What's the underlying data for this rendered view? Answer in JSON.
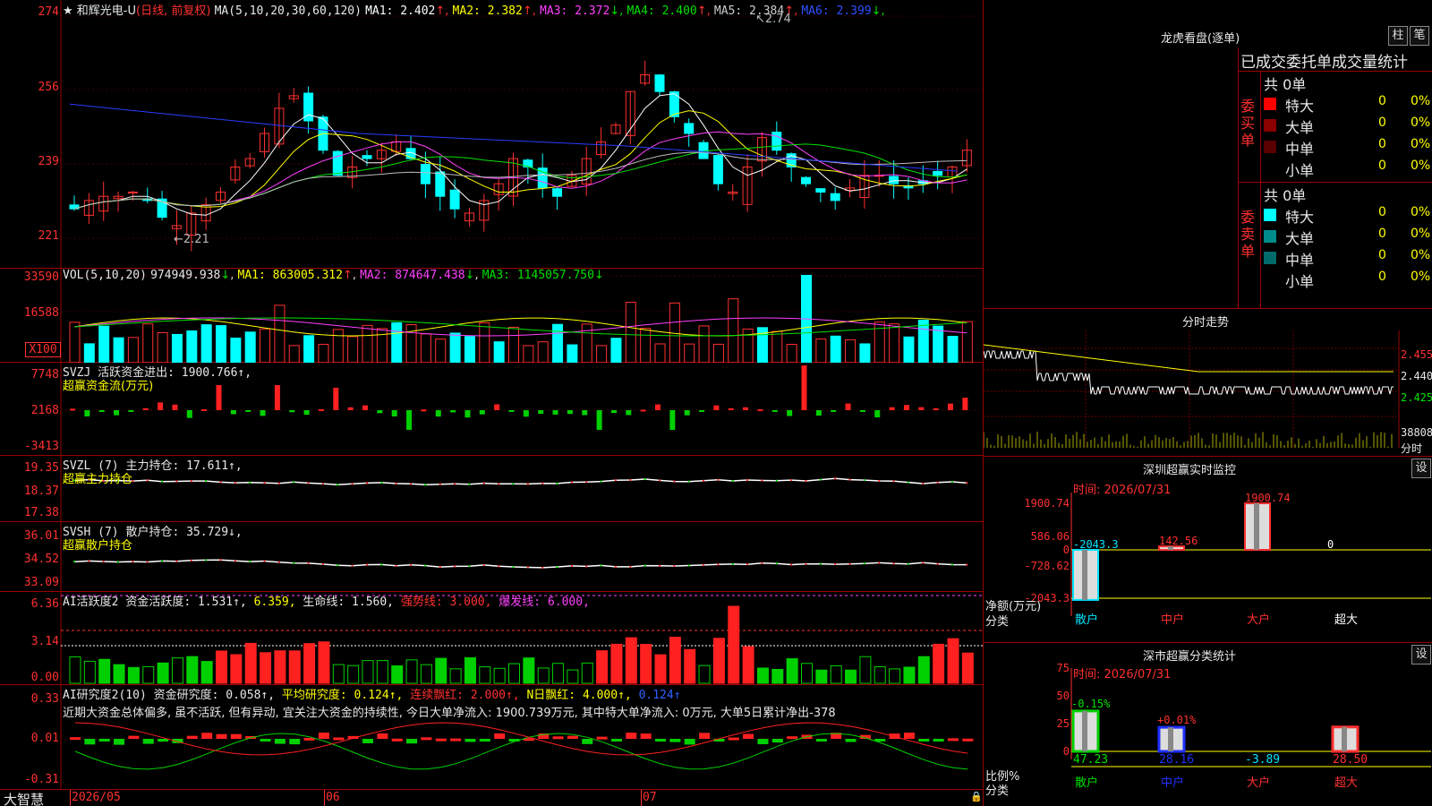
{
  "main": {
    "title_star": "★",
    "stock_name": "和辉光电-U",
    "period": "(日线, 前复权)",
    "ma_params": "MA(5,10,20,30,60,120)",
    "ma_values": [
      {
        "label": "MA1:",
        "value": "2.402",
        "arrow": "↑",
        "color": "#ffffff"
      },
      {
        "label": "MA2:",
        "value": "2.382",
        "arrow": "↑",
        "color": "#ffff00"
      },
      {
        "label": "MA3:",
        "value": "2.372",
        "arrow": "↓",
        "color": "#ff40ff"
      },
      {
        "label": "MA4:",
        "value": "2.400",
        "arrow": "↑",
        "color": "#00e000"
      },
      {
        "label": "MA5:",
        "value": "2.384",
        "arrow": "↑",
        "color": "#cccccc"
      },
      {
        "label": "MA6:",
        "value": "2.399",
        "arrow": "↓",
        "color": "#3050ff"
      }
    ],
    "y_ticks": [
      "274",
      "256",
      "239",
      "221"
    ],
    "high_marker": "2.74",
    "low_marker": "←2.21"
  },
  "volume": {
    "title": "VOL(5,10,20)",
    "value": "974949.938",
    "arrow": "↓",
    "ma": [
      {
        "label": "MA1:",
        "value": "863005.312",
        "arrow": "↑"
      },
      {
        "label": "MA2:",
        "value": "874647.438",
        "arrow": "↓"
      },
      {
        "label": "MA3:",
        "value": "1145057.750",
        "arrow": "↓"
      }
    ],
    "y_ticks": [
      "33590",
      "16588",
      "X100"
    ]
  },
  "svzj": {
    "title": "SVZJ  活跃资金进出: 1900.766↑,",
    "subtitle": "超赢资金流(万元)",
    "y_ticks": [
      "7748",
      "2168",
      "-3413"
    ]
  },
  "svzl": {
    "title": "SVZL (7) 主力持仓: 17.611↑,",
    "subtitle": "超赢主力持仓",
    "y_ticks": [
      "19.35",
      "18.37",
      "17.38"
    ]
  },
  "svsh": {
    "title": "SVSH (7) 散户持仓: 35.729↓,",
    "subtitle": "超赢散户持仓",
    "y_ticks": [
      "36.01",
      "34.52",
      "33.09"
    ]
  },
  "ai_active": {
    "title": "AI活跃度2",
    "label1": "资金活跃度: 1.531↑,",
    "v2": "6.359,",
    "label3": "生命线: 1.560,",
    "label4": "强势线: 3.000,",
    "label5": "爆发线: 6.000,",
    "y_ticks": [
      "6.36",
      "3.14",
      "0.00"
    ]
  },
  "ai_research": {
    "title": "AI研究度2(10)",
    "label1": "资金研究度: 0.058↑,",
    "label2": "平均研究度: 0.124↑,",
    "label3": "连续飘红: 2.000↑,",
    "label4": "N日飘红: 4.000↑,",
    "label5": "0.124↑",
    "comment": "近期大资金总体偏多, 虽不活跃, 但有异动, 宜关注大资金的持续性, 今日大单净流入: 1900.739万元, 其中特大单净流入: 0万元, 大单5日累计净出-378",
    "y_ticks": [
      "0.33",
      "0.01",
      "-0.31"
    ]
  },
  "bottom_bar": {
    "brand": "大智慧",
    "dates": [
      "2026/05",
      "06",
      "07"
    ]
  },
  "longhu": {
    "title": "龙虎看盘(逐单)",
    "btn1": "柱",
    "btn2": "笔",
    "header": "已成交委托单成交量统计",
    "buy_label": "委买单",
    "sell_label": "委卖单",
    "buy_total": "共 0单",
    "sell_total": "共 0单",
    "buy_rows": [
      {
        "name": "特大",
        "count": "0",
        "pct": "0%",
        "color": "#ff0000"
      },
      {
        "name": "大单",
        "count": "0",
        "pct": "0%",
        "color": "#8b0000"
      },
      {
        "name": "中单",
        "count": "0",
        "pct": "0%",
        "color": "#5a0000"
      },
      {
        "name": "小单",
        "count": "0",
        "pct": "0%",
        "color": "#000000"
      }
    ],
    "sell_rows": [
      {
        "name": "特大",
        "count": "0",
        "pct": "0%",
        "color": "#00ffff"
      },
      {
        "name": "大单",
        "count": "0",
        "pct": "0%",
        "color": "#008b8b"
      },
      {
        "name": "中单",
        "count": "0",
        "pct": "0%",
        "color": "#006a6a"
      },
      {
        "name": "小单",
        "count": "0",
        "pct": "0%",
        "color": "#000000"
      }
    ]
  },
  "intraday": {
    "title": "分时走势",
    "y_ticks": [
      "2.455",
      "2.440",
      "2.425"
    ],
    "vol_label": "38808",
    "time_label": "分时"
  },
  "monitor": {
    "title": "深圳超赢实时监控",
    "btn": "设",
    "time": "时间: 2026/07/31",
    "y_ticks": [
      "1900.74",
      "586.06",
      "0",
      "-728.62",
      "-2043.3"
    ],
    "axis_label": "净额(万元)",
    "axis_label2": "分类",
    "categories": [
      "散户",
      "中户",
      "大户",
      "超大"
    ],
    "values": [
      -2043.3,
      142.56,
      1900.74,
      0
    ],
    "value_labels": [
      "-2043.3",
      "142.56",
      "1900.74",
      "0"
    ]
  },
  "classify": {
    "title": "深市超赢分类统计",
    "btn": "设",
    "time": "时间: 2026/07/31",
    "y_ticks": [
      "75",
      "50",
      "25",
      "0"
    ],
    "axis_label": "比例%",
    "axis_label2": "分类",
    "categories": [
      "散户",
      "中户",
      "大户",
      "超大"
    ],
    "values": [
      47.23,
      28.16,
      -3.89,
      28.5
    ],
    "value_labels": [
      "47.23",
      "28.16",
      "-3.89",
      "28.50"
    ],
    "change_labels": [
      "-0.15%",
      "+0.01%",
      "",
      ""
    ]
  }
}
